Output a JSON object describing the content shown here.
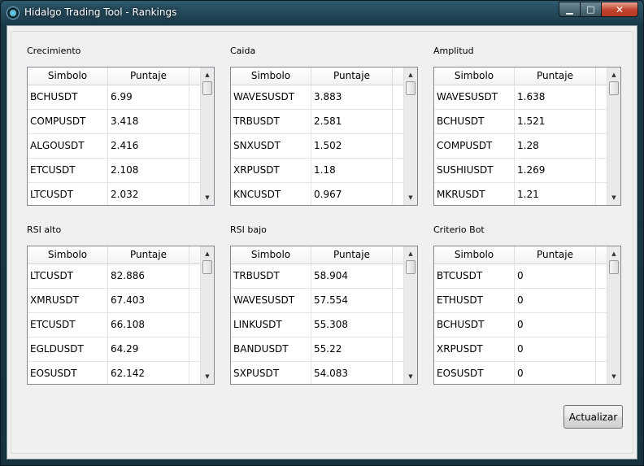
{
  "window": {
    "title": "Hidalgo Trading Tool - Rankings",
    "icon": "app-logo-icon",
    "controls": {
      "minimize": "▁",
      "maximize": "□",
      "close": "✕"
    }
  },
  "columns": {
    "symbol": "Simbolo",
    "score": "Puntaje"
  },
  "scroll_arrows": {
    "up": "▲",
    "down": "▼"
  },
  "tables": [
    {
      "label": "Crecimiento",
      "rows": [
        {
          "symbol": "BCHUSDT",
          "score": "6.99"
        },
        {
          "symbol": "COMPUSDT",
          "score": "3.418"
        },
        {
          "symbol": "ALGOUSDT",
          "score": "2.416"
        },
        {
          "symbol": "ETCUSDT",
          "score": "2.108"
        },
        {
          "symbol": "LTCUSDT",
          "score": "2.032"
        }
      ]
    },
    {
      "label": "Caida",
      "rows": [
        {
          "symbol": "WAVESUSDT",
          "score": "3.883"
        },
        {
          "symbol": "TRBUSDT",
          "score": "2.581"
        },
        {
          "symbol": "SNXUSDT",
          "score": "1.502"
        },
        {
          "symbol": "XRPUSDT",
          "score": "1.18"
        },
        {
          "symbol": "KNCUSDT",
          "score": "0.967"
        }
      ]
    },
    {
      "label": "Amplitud",
      "rows": [
        {
          "symbol": "WAVESUSDT",
          "score": "1.638"
        },
        {
          "symbol": "BCHUSDT",
          "score": "1.521"
        },
        {
          "symbol": "COMPUSDT",
          "score": "1.28"
        },
        {
          "symbol": "SUSHIUSDT",
          "score": "1.269"
        },
        {
          "symbol": "MKRUSDT",
          "score": "1.21"
        }
      ]
    },
    {
      "label": "RSI alto",
      "rows": [
        {
          "symbol": "LTCUSDT",
          "score": "82.886"
        },
        {
          "symbol": "XMRUSDT",
          "score": "67.403"
        },
        {
          "symbol": "ETCUSDT",
          "score": "66.108"
        },
        {
          "symbol": "EGLDUSDT",
          "score": "64.29"
        },
        {
          "symbol": "EOSUSDT",
          "score": "62.142"
        }
      ]
    },
    {
      "label": "RSI bajo",
      "rows": [
        {
          "symbol": "TRBUSDT",
          "score": "58.904"
        },
        {
          "symbol": "WAVESUSDT",
          "score": "57.554"
        },
        {
          "symbol": "LINKUSDT",
          "score": "55.308"
        },
        {
          "symbol": "BANDUSDT",
          "score": "55.22"
        },
        {
          "symbol": "SXPUSDT",
          "score": "54.083"
        }
      ]
    },
    {
      "label": "Criterio Bot",
      "rows": [
        {
          "symbol": "BTCUSDT",
          "score": "0"
        },
        {
          "symbol": "ETHUSDT",
          "score": "0"
        },
        {
          "symbol": "BCHUSDT",
          "score": "0"
        },
        {
          "symbol": "XRPUSDT",
          "score": "0"
        },
        {
          "symbol": "EOSUSDT",
          "score": "0"
        }
      ]
    }
  ],
  "actions": {
    "update_label": "Actualizar"
  }
}
